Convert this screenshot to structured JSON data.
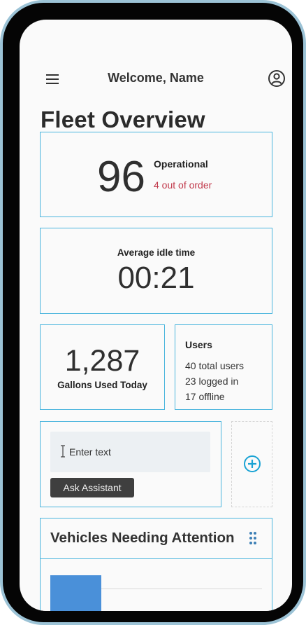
{
  "header": {
    "title": "Welcome, Name",
    "menu_icon": "hamburger-menu-icon",
    "account_icon": "account-circle-icon"
  },
  "page_title": "Fleet Overview",
  "operational": {
    "count": "96",
    "label": "Operational",
    "out_of_order": "4 out of order"
  },
  "idle": {
    "label": "Average idle time",
    "value": "00:21"
  },
  "gallons": {
    "value": "1,287",
    "label": "Gallons Used Today"
  },
  "users": {
    "title": "Users",
    "lines": [
      "40 total users",
      "23 logged in",
      "17 offline"
    ]
  },
  "assistant": {
    "placeholder": "Enter text",
    "button_label": "Ask Assistant"
  },
  "add_widget": {
    "icon": "add-circle-icon"
  },
  "vehicles": {
    "title": "Vehicles Needing Attention",
    "drag_icon": "drag-handle-icon"
  },
  "colors": {
    "accent": "#4ab5dd",
    "alert": "#c1394b",
    "button": "#3f3f3f",
    "bar_blue": "#4a90d9",
    "bar_amber": "#f0b429"
  }
}
